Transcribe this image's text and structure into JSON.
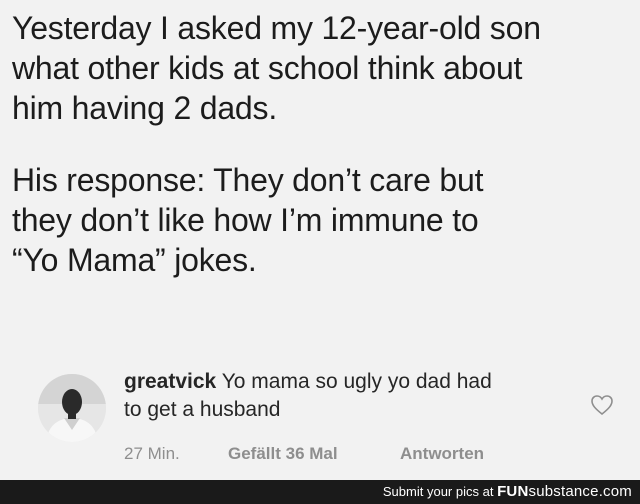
{
  "post": {
    "paragraph1": [
      "Yesterday I asked my 12-year-old son",
      "what other kids at school think about",
      "him having 2 dads."
    ],
    "paragraph2": [
      "His response: They don’t care but",
      "they don’t like how I’m immune to",
      "“Yo Mama” jokes."
    ]
  },
  "comment": {
    "username": "greatvick",
    "text_line1": "Yo mama so ugly yo dad had",
    "text_line2": "to get a husband",
    "time": "27 Min.",
    "likes": "Gefällt 36 Mal",
    "reply": "Antworten",
    "heart_icon": "heart-outline-icon"
  },
  "footer": {
    "prefix": "Submit your pics at",
    "logo_prefix": "FUN",
    "logo_main": "substance",
    "logo_suffix": ".com"
  }
}
